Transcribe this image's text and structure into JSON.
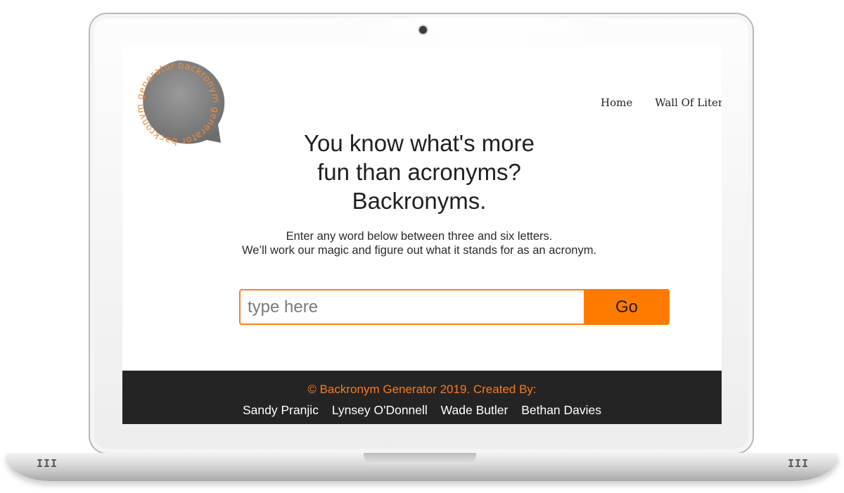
{
  "nav": {
    "home": "Home",
    "wall": "Wall Of Litera"
  },
  "logo": {
    "text": "backronym generator backronym generator"
  },
  "hero": {
    "line1": "You know what's more",
    "line2": "fun than acronyms?",
    "line3": "Backronyms."
  },
  "intro": {
    "line1": "Enter any word below between three and six letters.",
    "line2": "We’ll work our magic and figure out what it stands for as an acronym."
  },
  "form": {
    "placeholder": "type here",
    "value": "",
    "go_label": "Go"
  },
  "footer": {
    "copyright": "© Backronym Generator 2019. Created By:",
    "authors": [
      "Sandy Pranjic",
      "Lynsey O'Donnell",
      "Wade Butler",
      "Bethan Davies"
    ]
  },
  "colors": {
    "accent": "#ff7b00",
    "footer_bg": "#242424",
    "logo_fill": "#7a7a7a"
  },
  "vents": {
    "left": "III",
    "right": "III"
  }
}
